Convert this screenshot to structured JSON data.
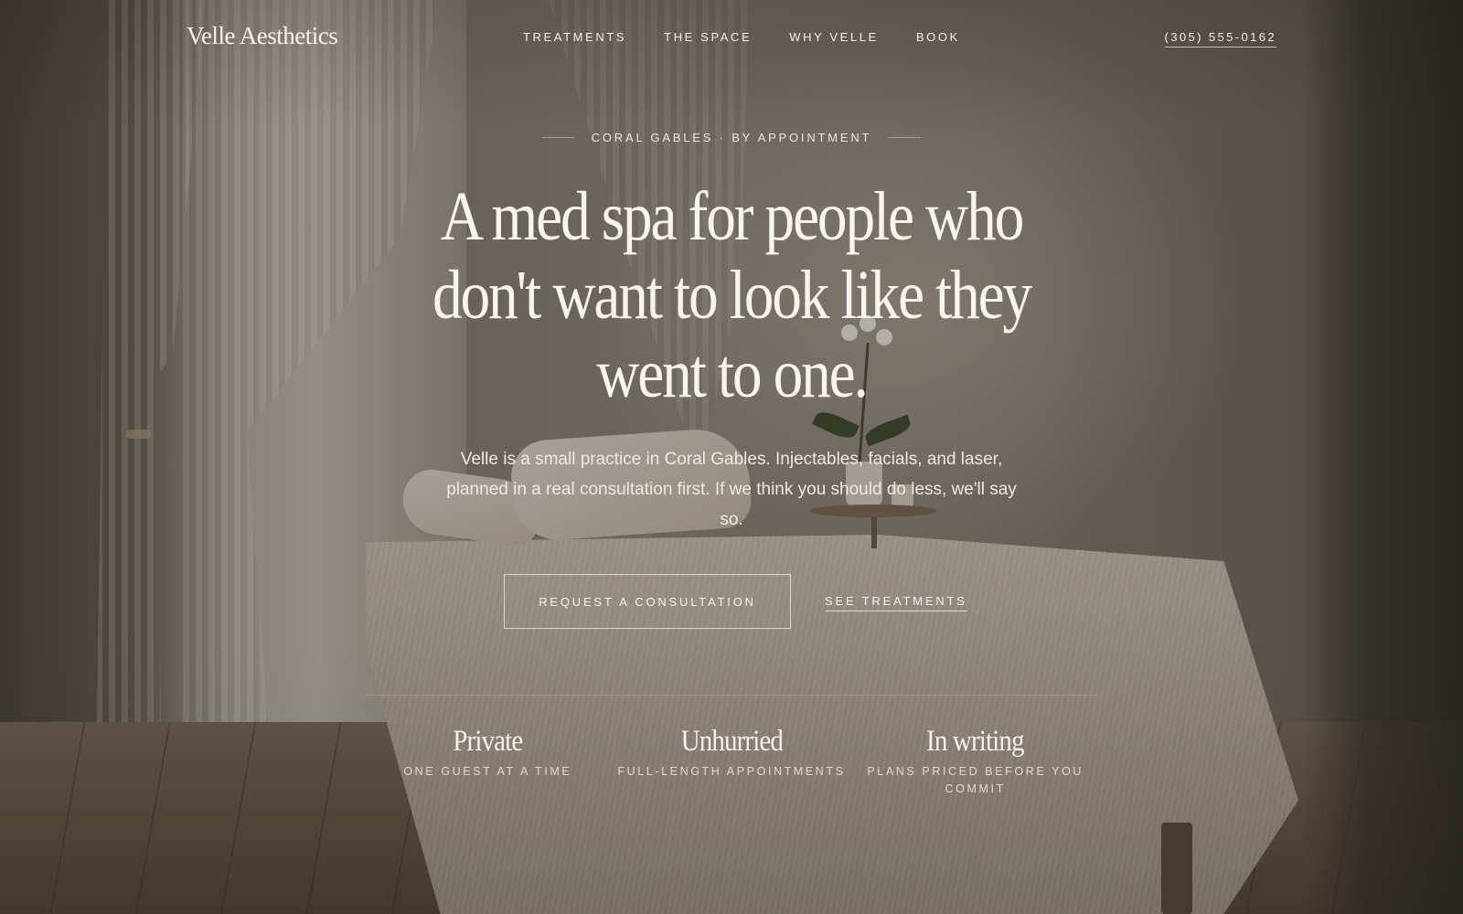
{
  "header": {
    "logo": "Velle Aesthetics",
    "nav": [
      "TREATMENTS",
      "THE SPACE",
      "WHY VELLE",
      "BOOK"
    ],
    "phone": "(305) 555-0162"
  },
  "hero": {
    "eyebrow": "CORAL GABLES · BY APPOINTMENT",
    "headline": "A med spa for people who don't want to look like they went to one.",
    "subhead": "Velle is a small practice in Coral Gables. Injectables, facials, and laser, planned in a real consultation first. If we think you should do less, we'll say so.",
    "primary_cta": "REQUEST A CONSULTATION",
    "secondary_cta": "SEE TREATMENTS"
  },
  "features": [
    {
      "title": "Private",
      "subtitle": "ONE GUEST AT A TIME"
    },
    {
      "title": "Unhurried",
      "subtitle": "FULL-LENGTH APPOINTMENTS"
    },
    {
      "title": "In writing",
      "subtitle": "PLANS PRICED BEFORE YOU COMMIT"
    }
  ],
  "colors": {
    "text": "#f4efe7",
    "overlay": "#1e1a16",
    "wall": "#8e867a",
    "floor": "#6a5a49"
  }
}
